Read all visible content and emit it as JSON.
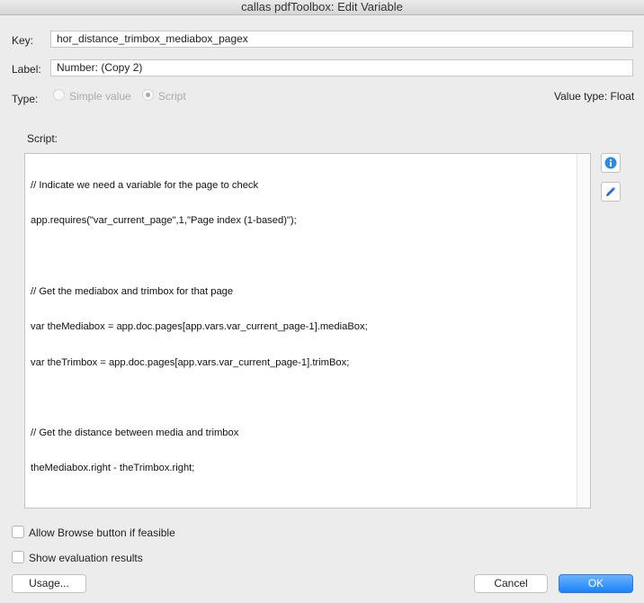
{
  "window": {
    "title": "callas pdfToolbox: Edit Variable"
  },
  "fields": {
    "key_label": "Key:",
    "key_value": "hor_distance_trimbox_mediabox_pagex",
    "label_label": "Label:",
    "label_value": "Number: (Copy 2)"
  },
  "type": {
    "label": "Type:",
    "options": [
      {
        "label": "Simple value",
        "selected": false,
        "enabled": false
      },
      {
        "label": "Script",
        "selected": true,
        "enabled": false
      }
    ],
    "value_type": "Value type: Float"
  },
  "script": {
    "label": "Script:",
    "lines": [
      "// Indicate we need a variable for the page to check",
      "app.requires(\"var_current_page\",1,\"Page index (1-based)\");",
      "",
      "// Get the mediabox and trimbox for that page",
      "var theMediabox = app.doc.pages[app.vars.var_current_page-1].mediaBox;",
      "var theTrimbox = app.doc.pages[app.vars.var_current_page-1].trimBox;",
      "",
      "// Get the distance between media and trimbox",
      "theMediabox.right - theTrimbox.right;"
    ]
  },
  "side_buttons": {
    "info_icon": "info-icon",
    "edit_icon": "pencil-icon"
  },
  "options": {
    "allow_browse": {
      "label": "Allow Browse button if feasible",
      "checked": false
    },
    "show_eval": {
      "label": "Show evaluation results",
      "checked": false
    }
  },
  "buttons": {
    "usage": "Usage...",
    "cancel": "Cancel",
    "ok": "OK"
  },
  "colors": {
    "accent": "#1a82fb",
    "info_icon": "#2a8be0"
  }
}
